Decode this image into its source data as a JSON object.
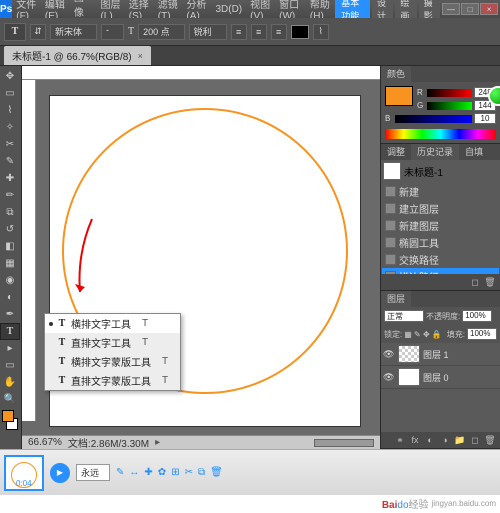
{
  "title": {
    "app": "Ps"
  },
  "menu": [
    "文件(F)",
    "编辑(E)",
    "图像(I)",
    "图层(L)",
    "选择(S)",
    "滤镜(T)",
    "分析(A)",
    "3D(D)",
    "视图(V)",
    "窗口(W)",
    "帮助(H)"
  ],
  "header_badges": {
    "primary": "基本功能",
    "b2": "设计",
    "b3": "绘画",
    "b4": "摄影"
  },
  "winbtns": {
    "min": "—",
    "max": "□",
    "close": "×"
  },
  "options": {
    "tool": "T",
    "font": "新宋体",
    "style": "-",
    "size_icon": "T",
    "size": "200 点",
    "aa": "锐利",
    "color_swatch": "#000000"
  },
  "doc": {
    "tab": "未标题-1 @ 66.7%(RGB/8)",
    "tab_close": "×",
    "zoom": "66.67%",
    "status": "文档:2.86M/3.30M"
  },
  "tools": {
    "list": [
      "move",
      "marquee",
      "lasso",
      "wand",
      "crop",
      "eyedrop",
      "heal",
      "brush",
      "stamp",
      "history",
      "eraser",
      "gradient",
      "blur",
      "dodge",
      "pen",
      "type",
      "path",
      "rect",
      "hand",
      "zoom"
    ],
    "active": "type"
  },
  "flyout": [
    {
      "sel": true,
      "icon": "T",
      "label": "横排文字工具",
      "key": "T"
    },
    {
      "sel": false,
      "icon": "T",
      "label": "直排文字工具",
      "key": "T"
    },
    {
      "sel": false,
      "icon": "T",
      "label": "横排文字蒙版工具",
      "key": "T"
    },
    {
      "sel": false,
      "icon": "T",
      "label": "直排文字蒙版工具",
      "key": "T"
    }
  ],
  "panels": {
    "color": {
      "tab": "颜色",
      "r": "248",
      "g": "144",
      "b": "10",
      "swatch": "#f7931e"
    },
    "history": {
      "tabs": [
        "调整",
        "历史记录",
        "自填"
      ],
      "doc": "未标题-1",
      "items": [
        {
          "label": "新建"
        },
        {
          "label": "建立图层"
        },
        {
          "label": "新建图层"
        },
        {
          "label": "椭圆工具"
        },
        {
          "label": "交换路径"
        },
        {
          "label": "描边路径",
          "sel": true
        }
      ]
    },
    "layers": {
      "tabs": [
        "图层"
      ],
      "mode": "正常",
      "opacity_label": "不透明度:",
      "opacity": "100%",
      "lock_label": "锁定:",
      "fill_label": "填充:",
      "fill": "100%",
      "rows": [
        {
          "name": "图层 1",
          "checker": true
        },
        {
          "name": "图层 0",
          "checker": false
        }
      ]
    }
  },
  "bottom": {
    "time": "0:04",
    "mode": "永远",
    "icons": [
      "✎",
      "↔",
      "✚",
      "✿",
      "⊞",
      "✂",
      "⧉",
      "🗑"
    ]
  },
  "watermark": {
    "brand1": "Bai",
    "brand2": "do",
    "brand3": "经验",
    "url": "jingyan.baidu.com"
  }
}
